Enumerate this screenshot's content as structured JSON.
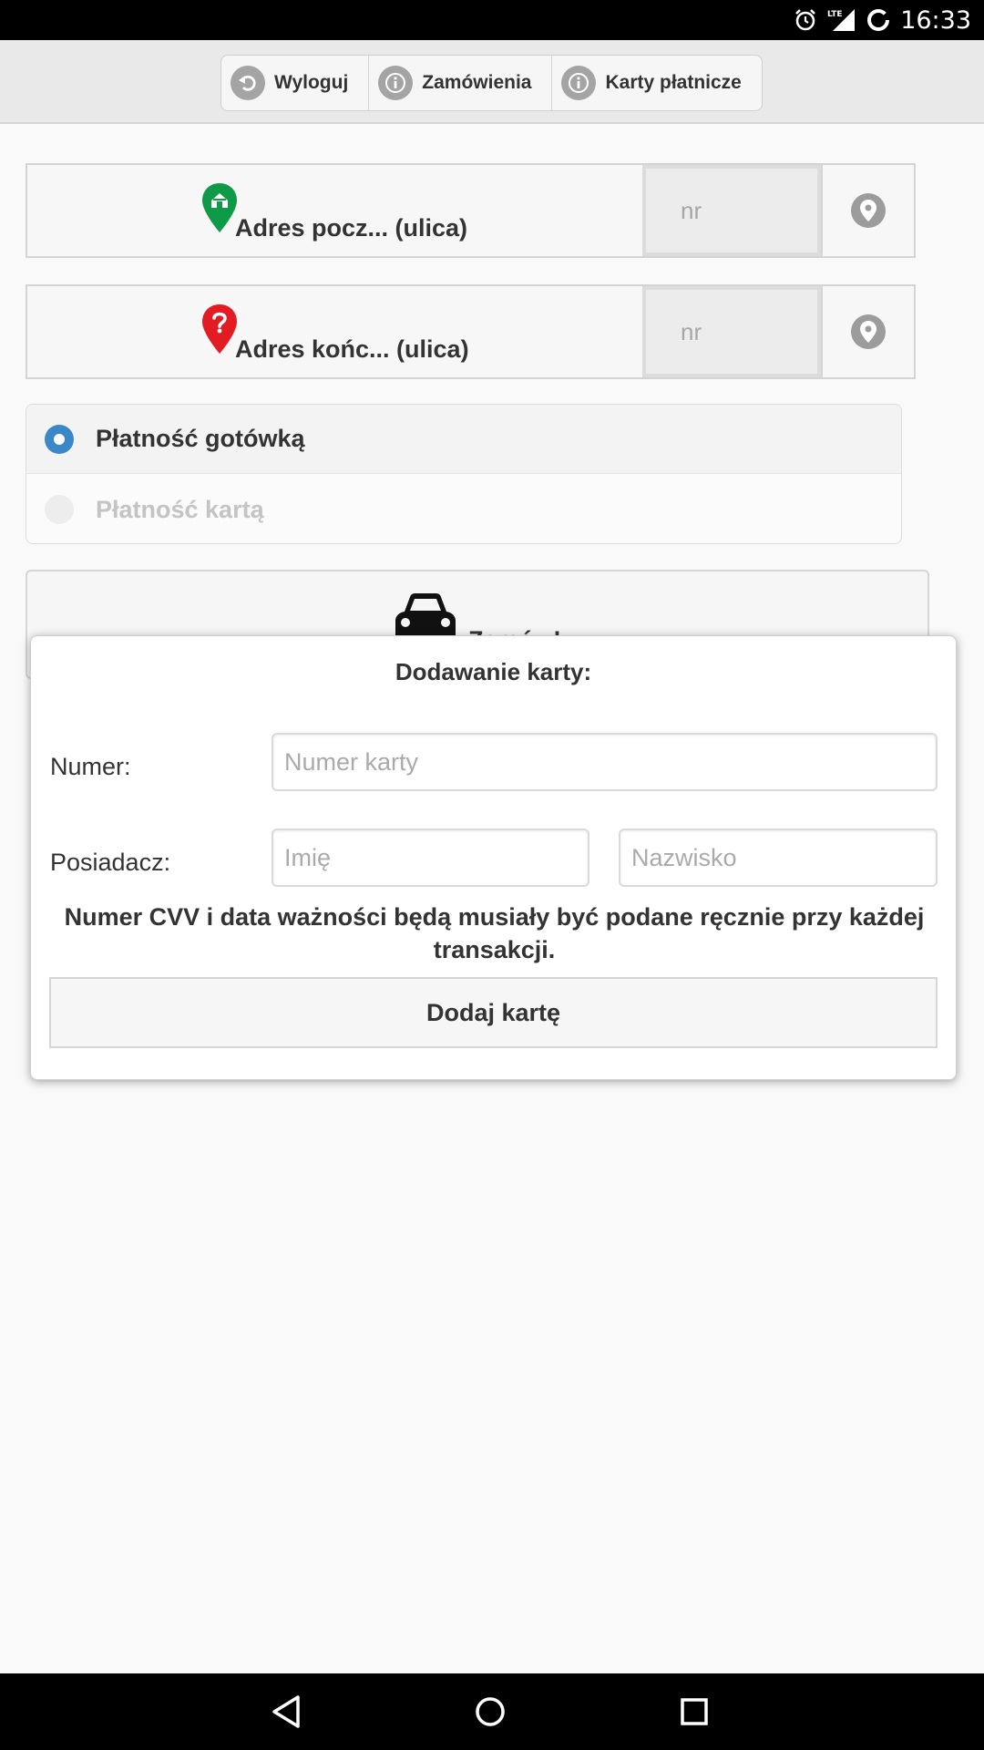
{
  "status_bar": {
    "time": "16:33",
    "network": "LTE",
    "icons": [
      "alarm-icon",
      "lte-signal-icon",
      "loading-icon"
    ]
  },
  "header": {
    "buttons": [
      {
        "label": "Wyloguj",
        "icon": "logout-icon"
      },
      {
        "label": "Zamówienia",
        "icon": "info-icon"
      },
      {
        "label": "Karty płatnicze",
        "icon": "info-icon"
      }
    ]
  },
  "addresses": {
    "start": {
      "label": "Adres pocz... (ulica)",
      "nr_placeholder": "nr",
      "pin_icon": "home-pin-icon",
      "pin_color": "#0e9a47"
    },
    "end": {
      "label": "Adres końc... (ulica)",
      "nr_placeholder": "nr",
      "pin_icon": "question-pin-icon",
      "pin_color": "#e31b23"
    }
  },
  "payment": {
    "options": [
      {
        "label": "Płatność gotówką",
        "selected": true,
        "enabled": true
      },
      {
        "label": "Płatność kartą",
        "selected": false,
        "enabled": false
      }
    ]
  },
  "order_button": {
    "label": "Zamów!",
    "icon": "car-icon"
  },
  "modal": {
    "title": "Dodawanie karty:",
    "number_label": "Numer:",
    "number_placeholder": "Numer karty",
    "holder_label": "Posiadacz:",
    "first_name_placeholder": "Imię",
    "last_name_placeholder": "Nazwisko",
    "note": "Numer CVV i data ważności będą musiały być podane ręcznie przy każdej transakcji.",
    "submit_label": "Dodaj kartę"
  },
  "colors": {
    "accent_radio": "#3b88c9",
    "start_pin": "#0e9a47",
    "end_pin": "#e31b23"
  }
}
